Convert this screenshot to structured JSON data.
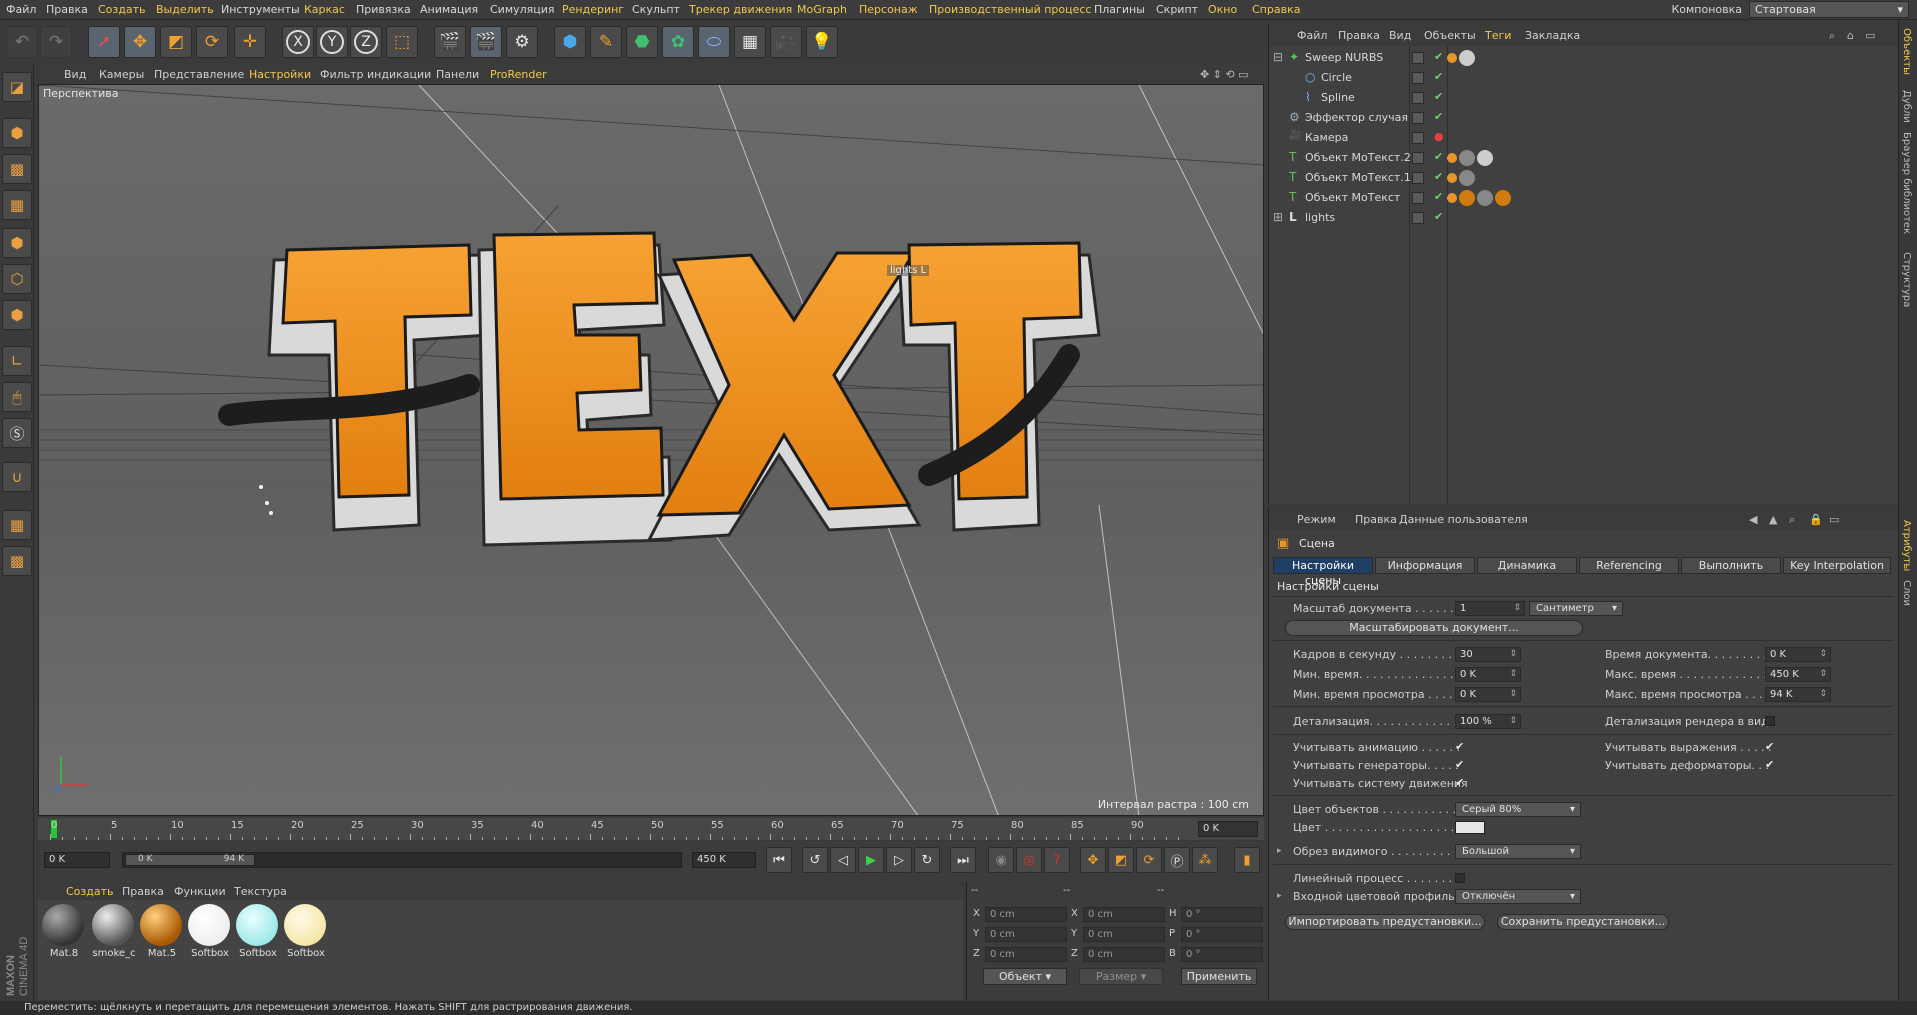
{
  "menubar": {
    "items": [
      "Файл",
      "Правка",
      "Создать",
      "Выделить",
      "Инструменты",
      "Каркас",
      "Привязка",
      "Анимация",
      "Симуляция",
      "Рендеринг",
      "Скульпт",
      "Трекер движения",
      "MoGraph",
      "Персонаж",
      "Производственный процесс",
      "Плагины",
      "Скрипт",
      "Окно",
      "Справка"
    ],
    "layout_label": "Компоновка",
    "layout_value": "Стартовая"
  },
  "toolbar": {
    "icons": [
      "undo-icon",
      "redo-icon",
      "select-icon",
      "move-icon",
      "scale-icon",
      "rotate-icon",
      "add-icon",
      "x-axis-icon",
      "y-axis-icon",
      "z-axis-icon",
      "coordinate-system-icon",
      "render-view-icon",
      "render-picture-queue-icon",
      "render-settings-icon",
      "cube-primitive-icon",
      "pen-spline-icon",
      "nurbs-icon",
      "mograph-cloner-icon",
      "deformer-icon",
      "floor-environment-icon",
      "camera-icon",
      "light-icon"
    ],
    "axis_labels": [
      "X",
      "Y",
      "Z"
    ]
  },
  "viewport": {
    "menu": [
      "Вид",
      "Камеры",
      "Представление",
      "Настройки",
      "Фильтр индикации",
      "Панели",
      "ProRender"
    ],
    "label": "Перспектива",
    "raster": "Интервал растра : 100 cm",
    "lights_tag": "lights",
    "text_3d": "TEXT"
  },
  "timeline": {
    "ticks": [
      "0",
      "5",
      "10",
      "15",
      "20",
      "25",
      "30",
      "35",
      "40",
      "45",
      "50",
      "55",
      "60",
      "65",
      "70",
      "75",
      "80",
      "85",
      "90"
    ],
    "current_frame": "0 K"
  },
  "playbar": {
    "start": "0 K",
    "range_start": "0 K",
    "range_end": "94 K",
    "end": "450 K"
  },
  "materials": {
    "menu": [
      "Создать",
      "Правка",
      "Функции",
      "Текстура"
    ],
    "items": [
      {
        "name": "Mat.8",
        "color": "#4a4a4a"
      },
      {
        "name": "smoke_c",
        "color": "#8a8a8a"
      },
      {
        "name": "Mat.5",
        "color": "#d17a10"
      },
      {
        "name": "Softbox",
        "color": "#ffffff"
      },
      {
        "name": "Softbox",
        "color": "#c8f6f6"
      },
      {
        "name": "Softbox",
        "color": "#fff3c8"
      }
    ]
  },
  "coords": {
    "header": [
      "--",
      "--",
      "--"
    ],
    "rows": [
      {
        "a": "X",
        "av": "0 cm",
        "b": "X",
        "bv": "0 cm",
        "c": "H",
        "cv": "0 °"
      },
      {
        "a": "Y",
        "av": "0 cm",
        "b": "Y",
        "bv": "0 cm",
        "c": "P",
        "cv": "0 °"
      },
      {
        "a": "Z",
        "av": "0 cm",
        "b": "Z",
        "bv": "0 cm",
        "c": "B",
        "cv": "0 °"
      }
    ],
    "object_dropdown": "Объект",
    "size_dropdown": "Размер",
    "apply_button": "Применить"
  },
  "status": "Переместить: щёлкнуть и перетащить для перемещения элементов. Нажать SHIFT для растрирования движения.",
  "objects": {
    "menu": [
      "Файл",
      "Правка",
      "Вид",
      "Объекты",
      "Теги",
      "Закладка"
    ],
    "tree": [
      {
        "name": "Sweep NURBS",
        "indent": 0,
        "icon": "sweep-nurbs-icon",
        "glyph": "✦",
        "tags": [
          "#e8962a",
          "#cccccc"
        ]
      },
      {
        "name": "Circle",
        "indent": 1,
        "icon": "circle-spline-icon",
        "glyph": "○",
        "tags": []
      },
      {
        "name": "Spline",
        "indent": 1,
        "icon": "spline-icon",
        "glyph": "⌇",
        "tags": []
      },
      {
        "name": "Эффектор случая",
        "indent": 0,
        "icon": "random-effector-icon",
        "glyph": "⚙",
        "tags": []
      },
      {
        "name": "Камера",
        "indent": 0,
        "icon": "camera-icon",
        "glyph": "🎥",
        "tags": []
      },
      {
        "name": "Объект MoТекст.2",
        "indent": 0,
        "icon": "motext-icon",
        "glyph": "T",
        "tags": [
          "#e8962a",
          "#888888",
          "#cccccc"
        ]
      },
      {
        "name": "Объект MoТекст.1",
        "indent": 0,
        "icon": "motext-icon",
        "glyph": "T",
        "tags": [
          "#e8962a",
          "#888888"
        ]
      },
      {
        "name": "Объект MoТекст",
        "indent": 0,
        "icon": "motext-icon",
        "glyph": "T",
        "tags": [
          "#e8962a",
          "#d17a10",
          "#888888",
          "#d17a10"
        ]
      },
      {
        "name": "lights",
        "indent": 0,
        "icon": "null-group-icon",
        "glyph": "L",
        "tags": []
      }
    ]
  },
  "attributes": {
    "menu": [
      "Режим",
      "Правка",
      "Данные пользователя"
    ],
    "title": "Сцена",
    "tabs": [
      "Настройки сцены",
      "Информация",
      "Динамика",
      "Referencing",
      "Выполнить",
      "Key Interpolation"
    ],
    "section": "Настройки сцены",
    "doc_scale_label": "Масштаб документа . . . . . . . .",
    "doc_scale_value": "1",
    "doc_scale_unit": "Сантиметр",
    "scale_doc_button": "Масштабировать документ...",
    "fps_label": "Кадров в секунду . . . . . . . . . .",
    "fps_value": "30",
    "min_time_label": "Мин. время. . . . . . . . . . . . . . .",
    "min_time_value": "0 K",
    "min_preview_label": "Мин. время просмотра . . . . . .",
    "min_preview_value": "0 K",
    "doc_time_label": "Время документа. . . . . . . . . .",
    "doc_time_value": "0 K",
    "max_time_label": "Макс. время . . . . . . . . . . . . .",
    "max_time_value": "450 K",
    "max_preview_label": "Макс. время просмотра . . . .",
    "max_preview_value": "94 K",
    "lod_label": "Детализация. . . . . . . . . . . . . .",
    "lod_value": "100 %",
    "render_lod_label": "Детализация рендера в виде",
    "use_anim_label": "Учитывать анимацию . . . . . .",
    "use_gen_label": "Учитывать генераторы. . . . .",
    "use_motion_label": "Учитывать систему движения",
    "use_expr_label": "Учитывать выражения . . . . .",
    "use_deform_label": "Учитывать деформаторы. . .",
    "obj_color_label": "Цвет объектов . . . . . . . . . . . .",
    "obj_color_value": "Серый 80%",
    "color_label": "Цвет . . . . . . . . . . . . . . . . . . . .",
    "clip_label": "Обрез видимого . . . . . . . . . .",
    "clip_value": "Большой",
    "linear_label": "Линейный процесс . . . . . . . .",
    "input_profile_label": "Входной цветовой профиль",
    "input_profile_value": "Отключён",
    "import_button": "Импортировать предустановки...",
    "save_button": "Сохранить предустановки..."
  },
  "right_tabs": [
    "Объекты",
    "Дубли",
    "Браузер библиотек",
    "Структура",
    "Атрибуты",
    "Слои"
  ]
}
